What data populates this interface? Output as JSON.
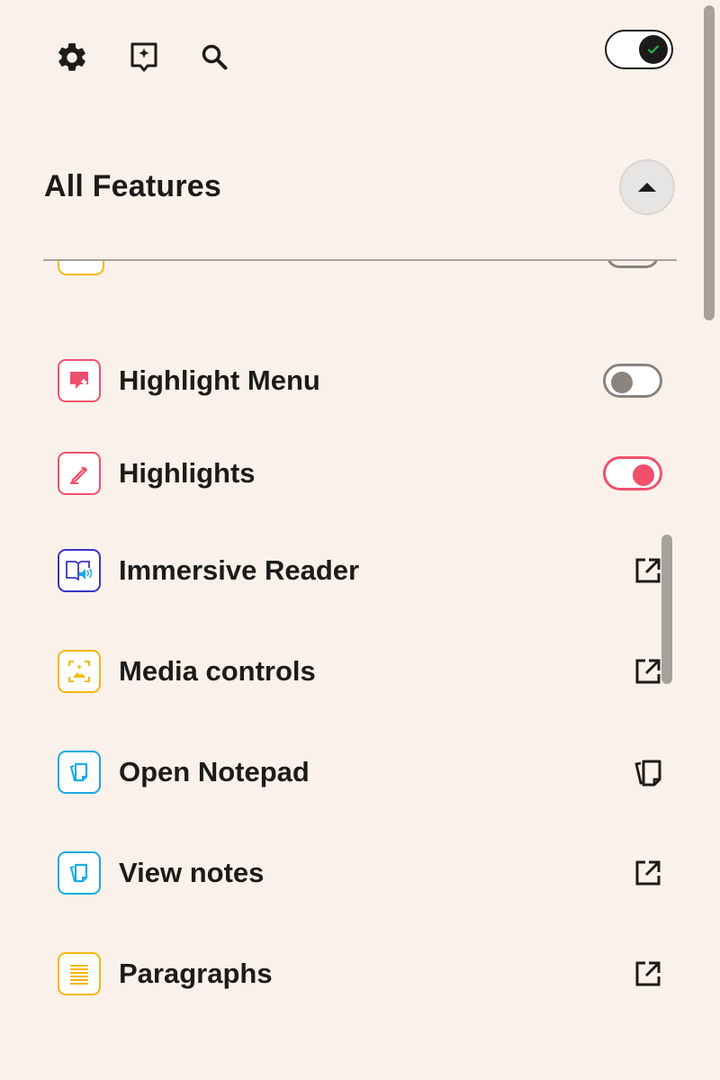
{
  "topbar": {
    "icons": [
      "gear-icon",
      "sparkle-note-icon",
      "search-icon"
    ],
    "master_toggle": {
      "on": true,
      "checkmark_color": "#1fb44a"
    }
  },
  "section": {
    "title": "All Features",
    "expanded": true
  },
  "features": [
    {
      "label": "Highlight Menu",
      "icon": "highlight-menu-icon",
      "color": "#f0506e",
      "action": "toggle",
      "enabled": false
    },
    {
      "label": "Highlights",
      "icon": "pencil-icon",
      "color": "#f0506e",
      "action": "toggle",
      "enabled": true
    },
    {
      "label": "Immersive Reader",
      "icon": "immersive-reader-icon",
      "color": "#3b34c4",
      "action": "external-link"
    },
    {
      "label": "Media controls",
      "icon": "media-icon",
      "color": "#f2b90d",
      "action": "external-link"
    },
    {
      "label": "Open Notepad",
      "icon": "notepad-icon",
      "color": "#1aa9e6",
      "action": "copy"
    },
    {
      "label": "View notes",
      "icon": "notepad-icon",
      "color": "#1aa9e6",
      "action": "external-link"
    },
    {
      "label": "Paragraphs",
      "icon": "paragraph-lines-icon",
      "color": "#f2b90d",
      "action": "external-link"
    }
  ],
  "colors": {
    "background": "#faf2ea",
    "toggle_on": "#f0506e",
    "toggle_off": "#8a8480"
  }
}
